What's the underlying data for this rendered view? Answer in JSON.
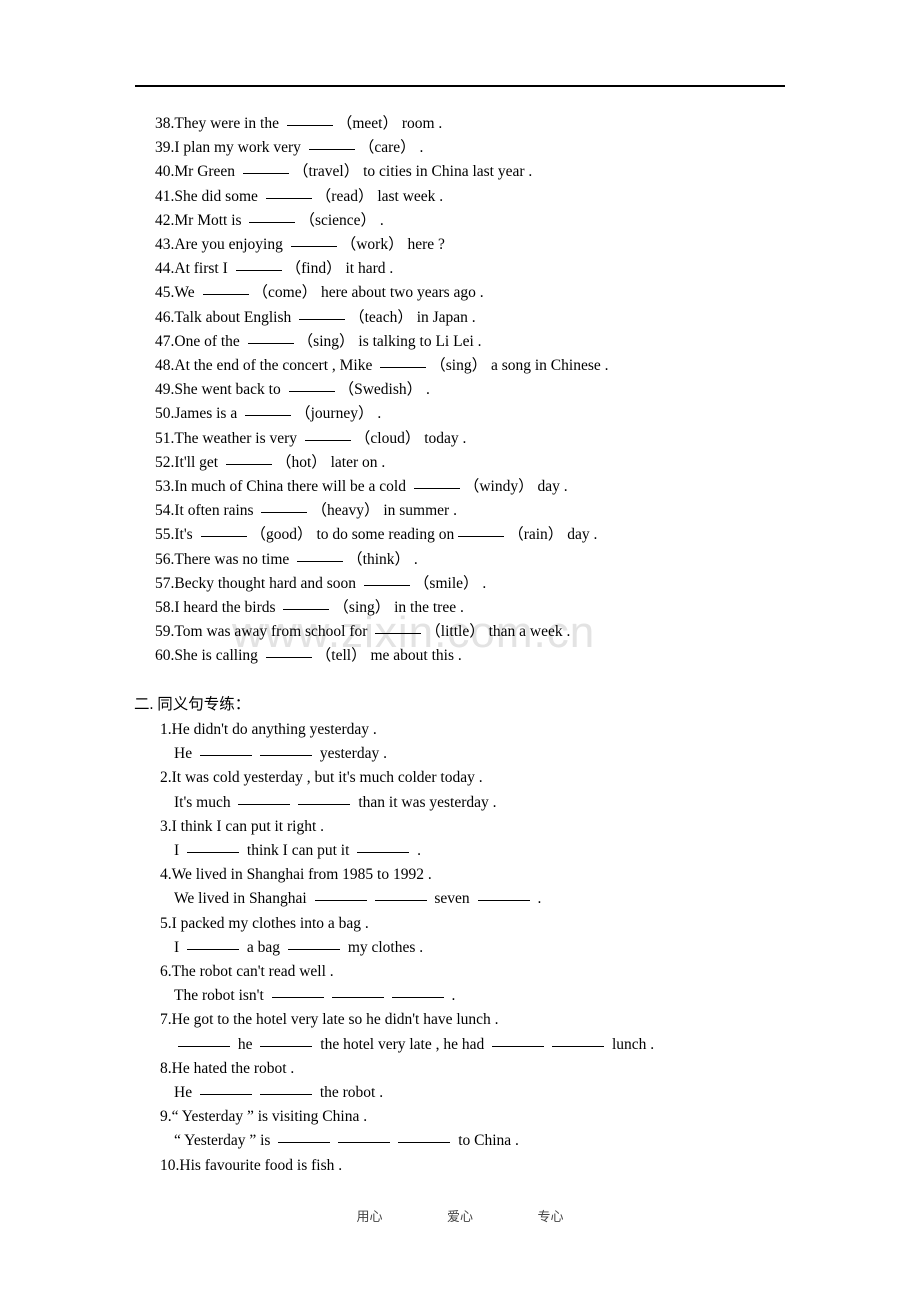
{
  "document": {
    "watermark": "www.zixin.com.cn",
    "footer": {
      "item1": "用心",
      "item2": "爱心",
      "item3": "专心"
    }
  },
  "section1": {
    "items": [
      {
        "num": "38.",
        "pre": "They were in the",
        "hint": "（meet）",
        "post": "room ."
      },
      {
        "num": "39.",
        "pre": "I plan my work very",
        "hint": "（care）",
        "post": "."
      },
      {
        "num": "40.",
        "pre": "Mr Green",
        "hint": "（travel）",
        "post": "to cities in China last year ."
      },
      {
        "num": "41.",
        "pre": "She did some",
        "hint": "（read）",
        "post": "last week ."
      },
      {
        "num": "42.",
        "pre": "Mr Mott is",
        "hint": "（science）",
        "post": "."
      },
      {
        "num": "43.",
        "pre": "Are you enjoying",
        "hint": "（work）",
        "post": "here ?"
      },
      {
        "num": "44.",
        "pre": "At first I",
        "hint": "（find）",
        "post": "it hard ."
      },
      {
        "num": "45.",
        "pre": "We",
        "hint": "（come）",
        "post": "here about two years ago ."
      },
      {
        "num": "46.",
        "pre": "Talk about English",
        "hint": "（teach）",
        "post": "in Japan ."
      },
      {
        "num": "47.",
        "pre": "One of the",
        "hint": "（sing）",
        "post": "is talking to Li Lei ."
      },
      {
        "num": "48.",
        "pre": "At the end of the concert , Mike",
        "hint": "（sing）",
        "post": "a song in Chinese ."
      },
      {
        "num": "49.",
        "pre": "She went back to",
        "hint": "（Swedish）",
        "post": "."
      },
      {
        "num": "50.",
        "pre": "James is a",
        "hint": "（journey）",
        "post": "."
      },
      {
        "num": "51.",
        "pre": "The weather is very",
        "hint": "（cloud）",
        "post": "today ."
      },
      {
        "num": "52.",
        "pre": "It'll get",
        "hint": "（hot）",
        "post": "later on ."
      },
      {
        "num": "53.",
        "pre": "In much of China there will be a cold",
        "hint": "（windy）",
        "post": "day ."
      },
      {
        "num": "54.",
        "pre": "It often rains",
        "hint": "（heavy）",
        "post": "in summer ."
      },
      {
        "num": "55.",
        "pre": "It's",
        "hint": "（good）",
        "post": "to do some reading on",
        "hint2": "（rain）",
        "post2": "day ."
      },
      {
        "num": "56.",
        "pre": "There was no time",
        "hint": "（think）",
        "post": "."
      },
      {
        "num": "57.",
        "pre": "Becky thought hard and soon",
        "hint": "（smile）",
        "post": "."
      },
      {
        "num": "58.",
        "pre": "I heard the birds",
        "hint": "（sing）",
        "post": "in the tree ."
      },
      {
        "num": "59.",
        "pre": "Tom was away from school for",
        "hint": "（little）",
        "post": "than a week ."
      },
      {
        "num": "60.",
        "pre": "She is calling",
        "hint": "（tell）",
        "post": "me about this ."
      }
    ]
  },
  "section2": {
    "heading": "二. 同义句专练：",
    "items": [
      {
        "num": "1.",
        "question": "He didn't do anything yesterday .",
        "answer_pre": "He",
        "answer_blanks": 2,
        "answer_post": "yesterday ."
      },
      {
        "num": "2.",
        "question": "It was cold yesterday , but it's much colder today .",
        "answer_pre": "It's much",
        "answer_blanks": 2,
        "answer_post": "than it was yesterday ."
      },
      {
        "num": "3.",
        "question": "I think I can put it right .",
        "answer_pre": "I",
        "answer_blanks": 1,
        "answer_mid": "think I can put it",
        "answer_blanks2": 1,
        "answer_post": "."
      },
      {
        "num": "4.",
        "question": "We lived in Shanghai from 1985 to 1992 .",
        "answer_pre": "We lived in Shanghai",
        "answer_blanks": 2,
        "answer_mid": "seven",
        "answer_blanks2": 1,
        "answer_post": "."
      },
      {
        "num": "5.",
        "question": "I packed my clothes into a bag .",
        "answer_pre": "I",
        "answer_blanks": 1,
        "answer_mid": "a bag",
        "answer_blanks2": 1,
        "answer_post": "my clothes ."
      },
      {
        "num": "6.",
        "question": "The robot can't read well .",
        "answer_pre": "The robot isn't",
        "answer_blanks": 3,
        "answer_post": "."
      },
      {
        "num": "7.",
        "question": "He got to the hotel very late so he didn't have lunch .",
        "answer_pre": "",
        "answer_blanks": 1,
        "answer_mid": "he",
        "answer_blanks2": 1,
        "answer_mid2": "the hotel very late , he had",
        "answer_blanks3": 2,
        "answer_post": "lunch ."
      },
      {
        "num": "8.",
        "question": "He hated the robot .",
        "answer_pre": "He",
        "answer_blanks": 2,
        "answer_post": "the robot ."
      },
      {
        "num": "9.",
        "question": "“ Yesterday ” is visiting China .",
        "answer_pre": "“ Yesterday ” is",
        "answer_blanks": 3,
        "answer_post": "to China ."
      },
      {
        "num": "10.",
        "question": "His favourite food is fish .",
        "answer_pre": "",
        "answer_blanks": 0,
        "answer_post": ""
      }
    ]
  }
}
